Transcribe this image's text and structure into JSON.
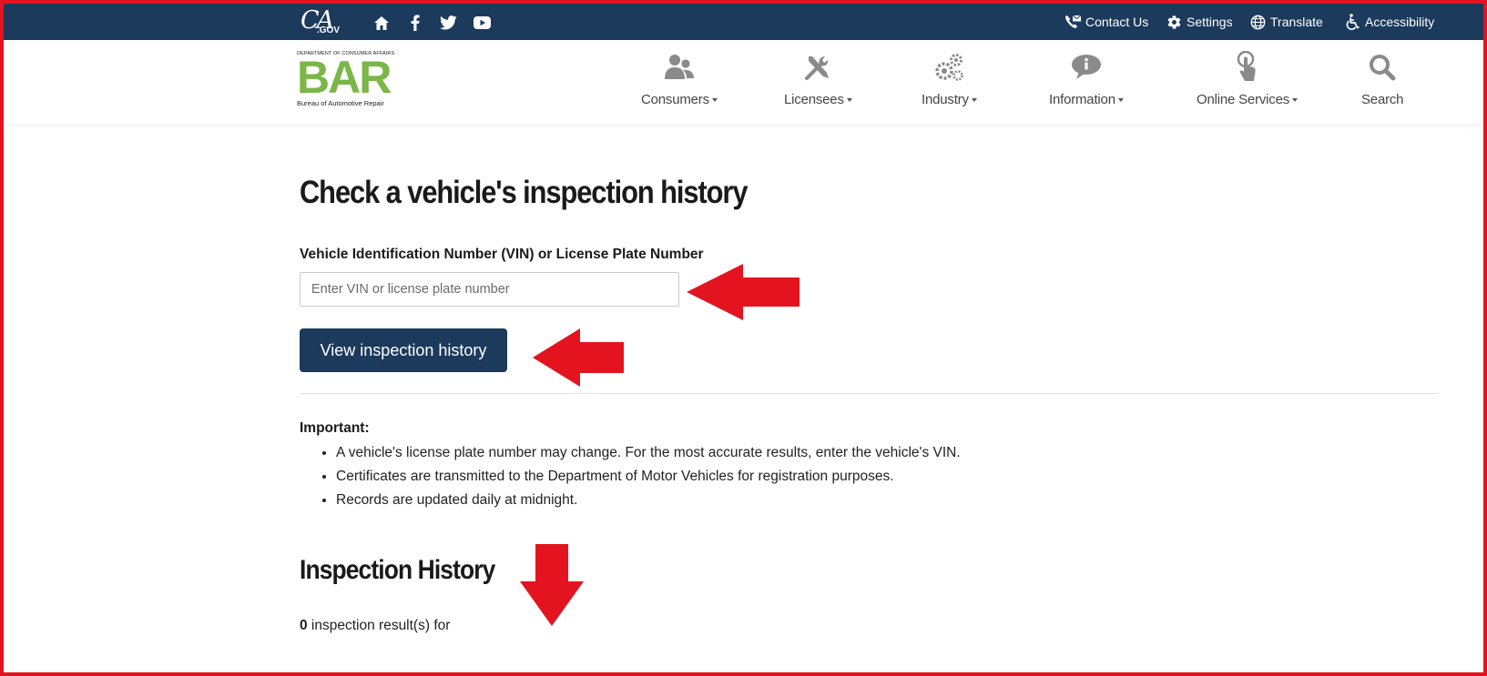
{
  "utility_bar": {
    "logo_text": "CA",
    "logo_sub": ".GOV",
    "links": [
      {
        "label": "Contact Us",
        "icon": "contact-icon"
      },
      {
        "label": "Settings",
        "icon": "gear-icon"
      },
      {
        "label": "Translate",
        "icon": "globe-icon"
      },
      {
        "label": "Accessibility",
        "icon": "accessibility-icon"
      }
    ],
    "social_icons": [
      "home-icon",
      "facebook-icon",
      "twitter-icon",
      "youtube-icon"
    ]
  },
  "header": {
    "logo": {
      "dept": "DEPARTMENT OF CONSUMER AFFAIRS",
      "mark": "BAR",
      "name": "Bureau of Automotive Repair"
    },
    "nav": [
      {
        "label": "Consumers",
        "icon": "users-icon",
        "dropdown": true
      },
      {
        "label": "Licensees",
        "icon": "tools-icon",
        "dropdown": true
      },
      {
        "label": "Industry",
        "icon": "gears-icon",
        "dropdown": true
      },
      {
        "label": "Information",
        "icon": "info-bubble-icon",
        "dropdown": true
      },
      {
        "label": "Online Services",
        "icon": "touch-icon",
        "dropdown": true
      },
      {
        "label": "Search",
        "icon": "search-icon",
        "dropdown": false
      }
    ]
  },
  "main": {
    "title": "Check a vehicle's inspection history",
    "field_label": "Vehicle Identification Number (VIN) or License Plate Number",
    "input_placeholder": "Enter VIN or license plate number",
    "input_value": "",
    "button_label": "View inspection history",
    "important_label": "Important:",
    "notes": [
      "A vehicle's license plate number may change. For the most accurate results, enter the vehicle's VIN.",
      "Certificates are transmitted to the Department of Motor Vehicles for registration purposes.",
      "Records are updated daily at midnight."
    ],
    "history_title": "Inspection History",
    "result_count": "0",
    "result_text": " inspection result(s) for"
  },
  "colors": {
    "navy": "#1b3a5c",
    "bar_green": "#7ab648",
    "annotation_red": "#e3141f",
    "nav_icon_grey": "#8a8a8a"
  }
}
